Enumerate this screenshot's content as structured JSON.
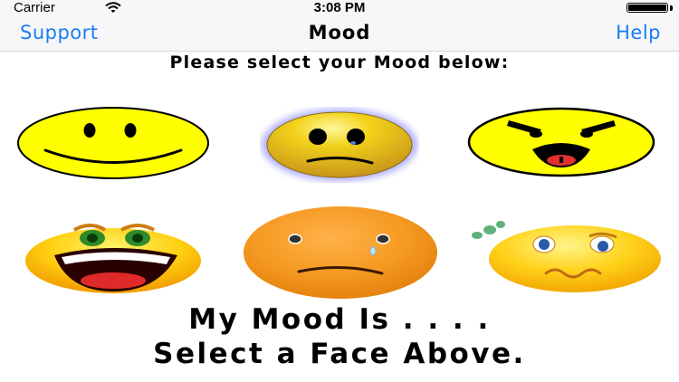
{
  "status_bar": {
    "carrier": "Carrier",
    "time": "3:08 PM",
    "icons": [
      "wifi-icon",
      "battery-icon"
    ]
  },
  "nav": {
    "left_label": "Support",
    "title": "Mood",
    "right_label": "Help",
    "accent_color": "#1a7cf5"
  },
  "prompt": "Please select your Mood below:",
  "faces": [
    {
      "icon": "happy-face-icon"
    },
    {
      "icon": "sad-face-icon"
    },
    {
      "icon": "angry-face-icon"
    },
    {
      "icon": "laughing-face-icon"
    },
    {
      "icon": "crying-face-icon"
    },
    {
      "icon": "queasy-face-icon"
    }
  ],
  "result": {
    "line1": "My Mood Is . . . .",
    "line2": "Select a Face Above."
  }
}
